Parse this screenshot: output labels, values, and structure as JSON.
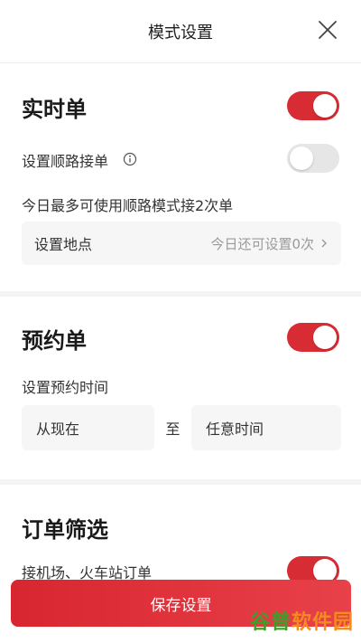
{
  "header": {
    "title": "模式设置"
  },
  "realtime": {
    "title": "实时单",
    "enabled": true,
    "shunlu_label": "设置顺路接单",
    "shunlu_enabled": false,
    "limit_text": "今日最多可使用顺路模式接2次单",
    "location_label": "设置地点",
    "location_remaining": "今日还可设置0次"
  },
  "reservation": {
    "title": "预约单",
    "enabled": true,
    "time_label": "设置预约时间",
    "from": "从现在",
    "separator": "至",
    "to": "任意时间"
  },
  "filter": {
    "title": "订单筛选",
    "clipped_row_text": "接机场、火车站订单"
  },
  "footer": {
    "save_label": "保存设置"
  },
  "watermark": {
    "part1": "谷普",
    "part2": "软件园"
  },
  "colors": {
    "accent": "#d82c34",
    "toggle_off": "#e6e6e6"
  }
}
